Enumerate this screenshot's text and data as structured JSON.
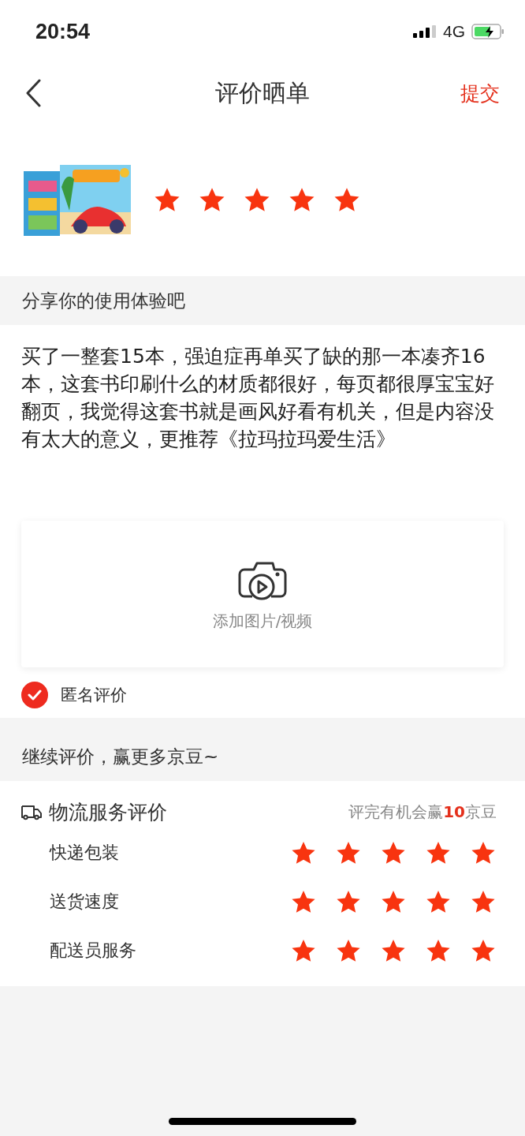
{
  "status_bar": {
    "time": "20:54",
    "network": "4G"
  },
  "nav": {
    "title": "评价晒单",
    "action": "提交"
  },
  "product": {
    "stars": 5
  },
  "review": {
    "prompt": "分享你的使用体验吧",
    "text": "买了一整套15本，强迫症再单买了缺的那一本凑齐16本，这套书印刷什么的材质都很好，每页都很厚宝宝好翻页，我觉得这套书就是画风好看有机关，但是内容没有太大的意义，更推荐《拉玛拉玛爱生活》"
  },
  "upload": {
    "label": "添加图片/视频"
  },
  "anonymous": {
    "label": "匿名评价",
    "checked": true
  },
  "more": {
    "label": "继续评价，赢更多京豆~"
  },
  "logistics": {
    "title": "物流服务评价",
    "bonus": "评完有机会赢**10**京豆",
    "items": [
      {
        "label": "快递包装",
        "stars": 5
      },
      {
        "label": "送货速度",
        "stars": 5
      },
      {
        "label": "配送员服务",
        "stars": 5
      }
    ]
  }
}
